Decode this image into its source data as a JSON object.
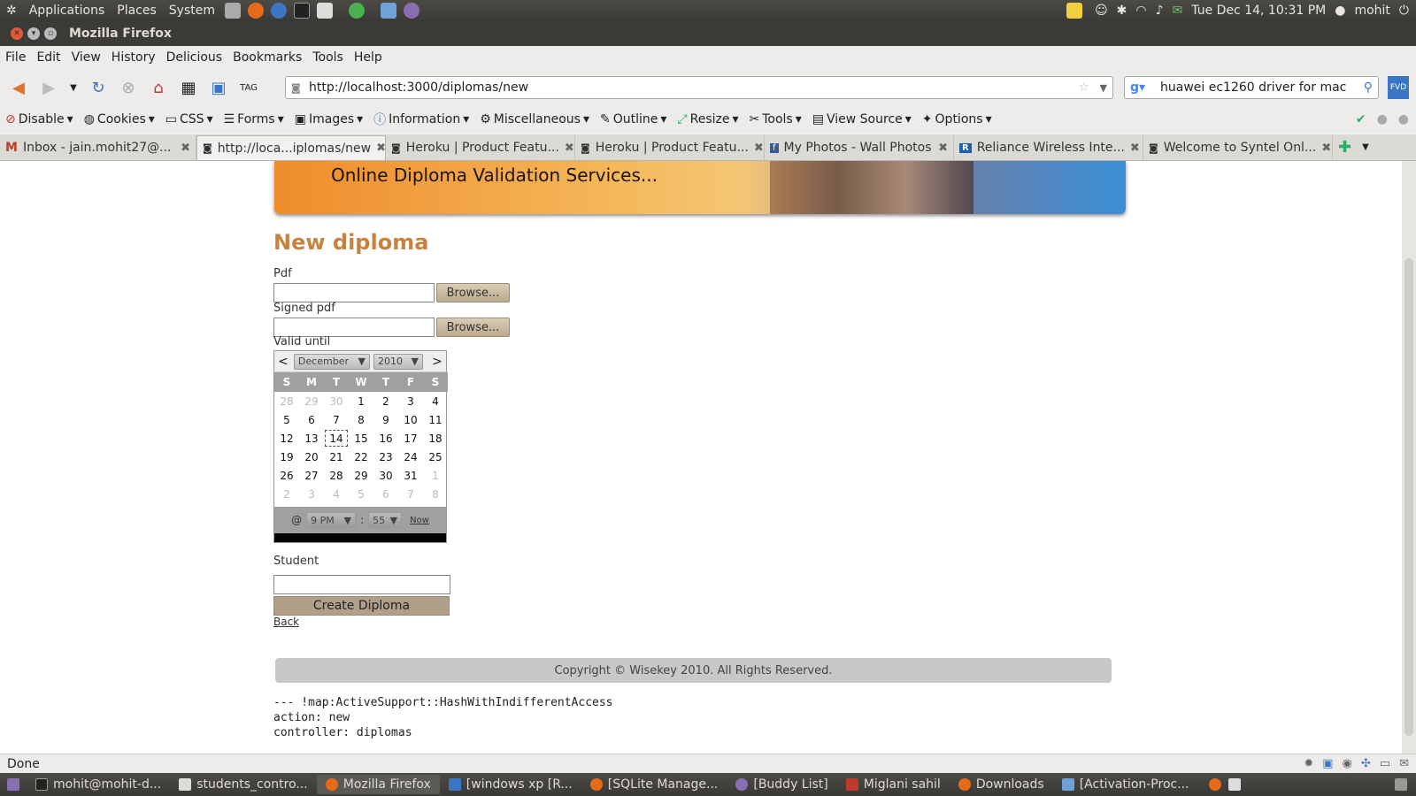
{
  "system": {
    "menus": [
      "Applications",
      "Places",
      "System"
    ],
    "datetime": "Tue Dec 14, 10:31 PM",
    "user": "mohit"
  },
  "window": {
    "title": "Mozilla Firefox"
  },
  "menubar": [
    "File",
    "Edit",
    "View",
    "History",
    "Delicious",
    "Bookmarks",
    "Tools",
    "Help"
  ],
  "nav": {
    "url": "http://localhost:3000/diplomas/new",
    "search": "huawei ec1260 driver for mac",
    "fvd_label": "FVD"
  },
  "webdev": [
    "Disable",
    "Cookies",
    "CSS",
    "Forms",
    "Images",
    "Information",
    "Miscellaneous",
    "Outline",
    "Resize",
    "Tools",
    "View Source",
    "Options"
  ],
  "tabs": [
    {
      "label": "Inbox - jain.mohit27@...",
      "icon": "M"
    },
    {
      "label": "http://loca...iplomas/new",
      "icon": "page"
    },
    {
      "label": "Heroku | Product Featu...",
      "icon": "page"
    },
    {
      "label": "Heroku | Product Featu...",
      "icon": "page"
    },
    {
      "label": "My Photos - Wall Photos",
      "icon": "f"
    },
    {
      "label": "Reliance Wireless Inte...",
      "icon": "R"
    },
    {
      "label": "Welcome to Syntel Onl...",
      "icon": "page"
    }
  ],
  "page": {
    "banner": "Online Diploma Validation Services...",
    "title": "New diploma",
    "pdf_label": "Pdf",
    "signed_pdf_label": "Signed pdf",
    "browse": "Browse...",
    "valid_until_label": "Valid until",
    "student_label": "Student",
    "submit": "Create Diploma",
    "back": "Back",
    "footer": "Copyright © Wisekey 2010. All Rights Reserved.",
    "debug": [
      "--- !map:ActiveSupport::HashWithIndifferentAccess",
      "action: new",
      "controller: diplomas"
    ]
  },
  "calendar": {
    "prev": "<",
    "next": ">",
    "month": "December",
    "year": "2010",
    "weekdays": [
      "S",
      "M",
      "T",
      "W",
      "T",
      "F",
      "S"
    ],
    "weeks": [
      [
        "28",
        "29",
        "30",
        "1",
        "2",
        "3",
        "4"
      ],
      [
        "5",
        "6",
        "7",
        "8",
        "9",
        "10",
        "11"
      ],
      [
        "12",
        "13",
        "14",
        "15",
        "16",
        "17",
        "18"
      ],
      [
        "19",
        "20",
        "21",
        "22",
        "23",
        "24",
        "25"
      ],
      [
        "26",
        "27",
        "28",
        "29",
        "30",
        "31",
        "1"
      ],
      [
        "2",
        "3",
        "4",
        "5",
        "6",
        "7",
        "8"
      ]
    ],
    "other_month": [
      [
        0,
        0
      ],
      [
        0,
        1
      ],
      [
        0,
        2
      ],
      [
        4,
        6
      ],
      [
        5,
        0
      ],
      [
        5,
        1
      ],
      [
        5,
        2
      ],
      [
        5,
        3
      ],
      [
        5,
        4
      ],
      [
        5,
        5
      ],
      [
        5,
        6
      ]
    ],
    "today": "14",
    "at": "@",
    "hour": "9 PM",
    "colon": ":",
    "minute": "55",
    "now": "Now"
  },
  "status": "Done",
  "taskbar": [
    {
      "label": "mohit@mohit-d...",
      "active": false
    },
    {
      "label": "students_contro...",
      "active": false
    },
    {
      "label": "Mozilla Firefox",
      "active": true
    },
    {
      "label": "[windows xp [R...",
      "active": false
    },
    {
      "label": "[SQLite Manage...",
      "active": false
    },
    {
      "label": "[Buddy List]",
      "active": false
    },
    {
      "label": "Miglani sahil",
      "active": false
    },
    {
      "label": "Downloads",
      "active": false
    },
    {
      "label": "[Activation-Proc...",
      "active": false
    }
  ]
}
